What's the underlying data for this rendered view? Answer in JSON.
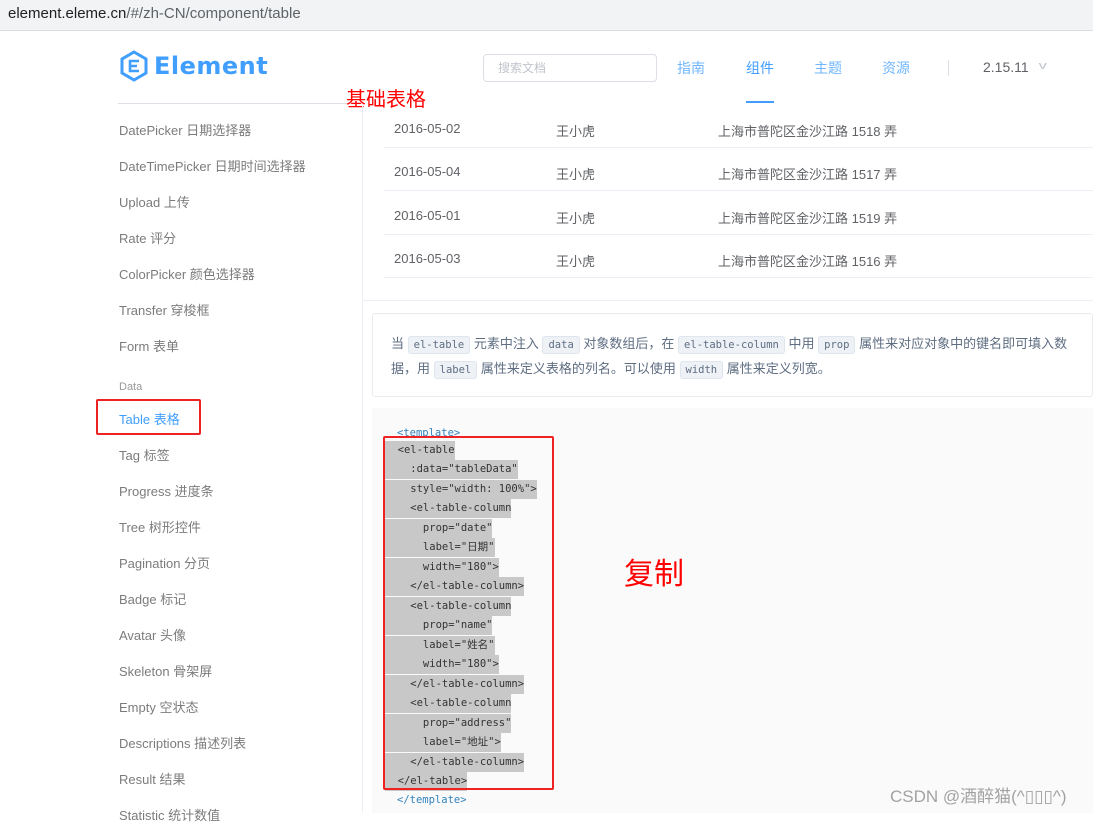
{
  "browser": {
    "url_host": "element.eleme.cn",
    "url_path": "/#/zh-CN/component/table"
  },
  "header": {
    "logo_text": "Element",
    "search_placeholder": "搜索文档",
    "nav": [
      {
        "label": "指南",
        "active": false
      },
      {
        "label": "组件",
        "active": true
      },
      {
        "label": "主题",
        "active": false
      },
      {
        "label": "资源",
        "active": false
      }
    ],
    "version": "2.15.11"
  },
  "annotations": {
    "title": "基础表格",
    "copy": "复制"
  },
  "sidebar": {
    "items_before": [
      "DatePicker 日期选择器",
      "DateTimePicker 日期时间选择器",
      "Upload 上传",
      "Rate 评分",
      "ColorPicker 颜色选择器",
      "Transfer 穿梭框",
      "Form 表单"
    ],
    "group_label": "Data",
    "active_item": "Table 表格",
    "items_after": [
      "Tag 标签",
      "Progress 进度条",
      "Tree 树形控件",
      "Pagination 分页",
      "Badge 标记",
      "Avatar 头像",
      "Skeleton 骨架屏",
      "Empty 空状态",
      "Descriptions 描述列表",
      "Result 结果",
      "Statistic 统计数值"
    ]
  },
  "table": {
    "rows": [
      {
        "date": "2016-05-02",
        "name": "王小虎",
        "address": "上海市普陀区金沙江路 1518 弄"
      },
      {
        "date": "2016-05-04",
        "name": "王小虎",
        "address": "上海市普陀区金沙江路 1517 弄"
      },
      {
        "date": "2016-05-01",
        "name": "王小虎",
        "address": "上海市普陀区金沙江路 1519 弄"
      },
      {
        "date": "2016-05-03",
        "name": "王小虎",
        "address": "上海市普陀区金沙江路 1516 弄"
      }
    ]
  },
  "description": {
    "t1": "当",
    "c1": "el-table",
    "t2": "元素中注入",
    "c2": "data",
    "t3": "对象数组后，在",
    "c3": "el-table-column",
    "t4": "中用",
    "c4": "prop",
    "t5": "属性来对应对象中的键名即可填入数据，用",
    "c5": "label",
    "t6": "属性来定义表格的列名。可以使用",
    "c6": "width",
    "t7": "属性来定义列宽。"
  },
  "code": {
    "open_template": "<template>",
    "lines": [
      "  <el-table",
      "    :data=\"tableData\"",
      "    style=\"width: 100%\">",
      "    <el-table-column",
      "      prop=\"date\"",
      "      label=\"日期\"",
      "      width=\"180\">",
      "    </el-table-column>",
      "    <el-table-column",
      "      prop=\"name\"",
      "      label=\"姓名\"",
      "      width=\"180\">",
      "    </el-table-column>",
      "    <el-table-column",
      "      prop=\"address\"",
      "      label=\"地址\">",
      "    </el-table-column>",
      "  </el-table>"
    ],
    "close_template": "</template>"
  },
  "watermark": "CSDN @酒醉猫(^▯▯▯^)"
}
